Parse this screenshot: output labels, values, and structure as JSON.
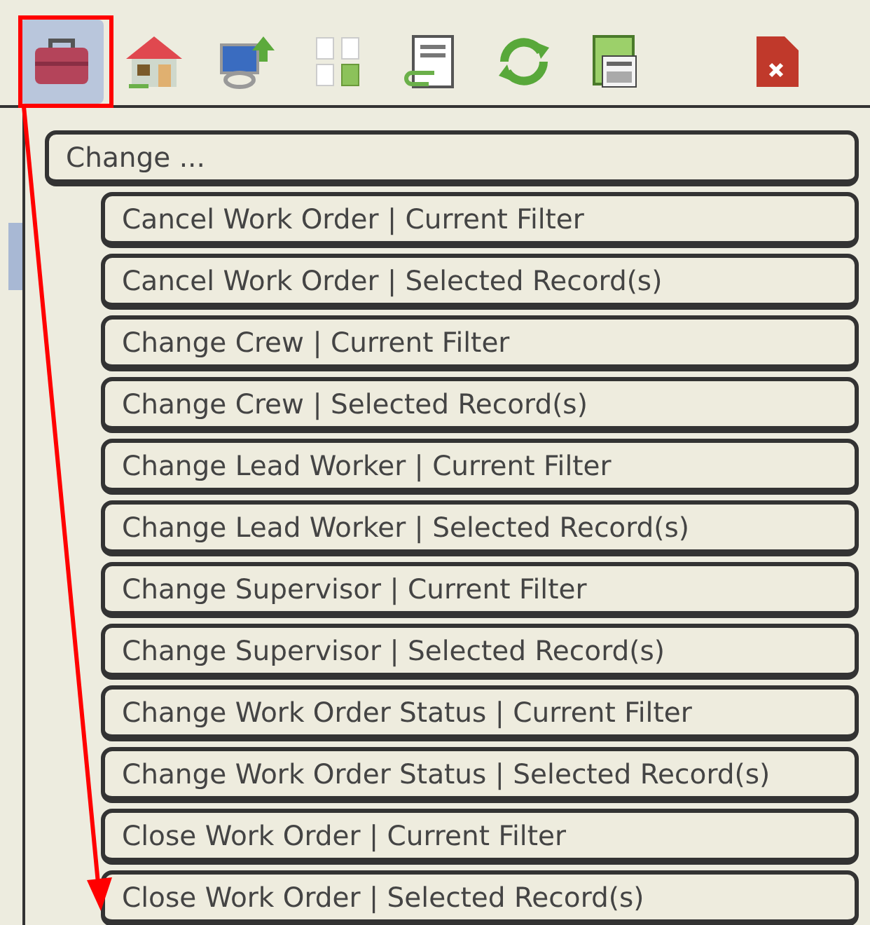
{
  "toolbar": [
    {
      "selected": true
    },
    {
      "selected": false
    },
    {
      "selected": false
    },
    {
      "selected": false
    },
    {
      "selected": false
    },
    {
      "selected": false
    },
    {
      "selected": false
    },
    {
      "selected": false
    }
  ],
  "annotation": {
    "highlight": true,
    "arrow": true
  },
  "menu": {
    "header": "Change ...",
    "items": [
      "Cancel Work Order | Current Filter",
      "Cancel Work Order | Selected Record(s)",
      "Change Crew | Current Filter",
      "Change Crew | Selected Record(s)",
      "Change Lead Worker | Current Filter",
      "Change Lead Worker | Selected Record(s)",
      "Change Supervisor | Current Filter",
      "Change Supervisor | Selected Record(s)",
      "Change Work Order Status | Current Filter",
      "Change Work Order Status | Selected Record(s)",
      "Close Work Order | Current Filter",
      "Close Work Order | Selected Record(s)"
    ]
  }
}
